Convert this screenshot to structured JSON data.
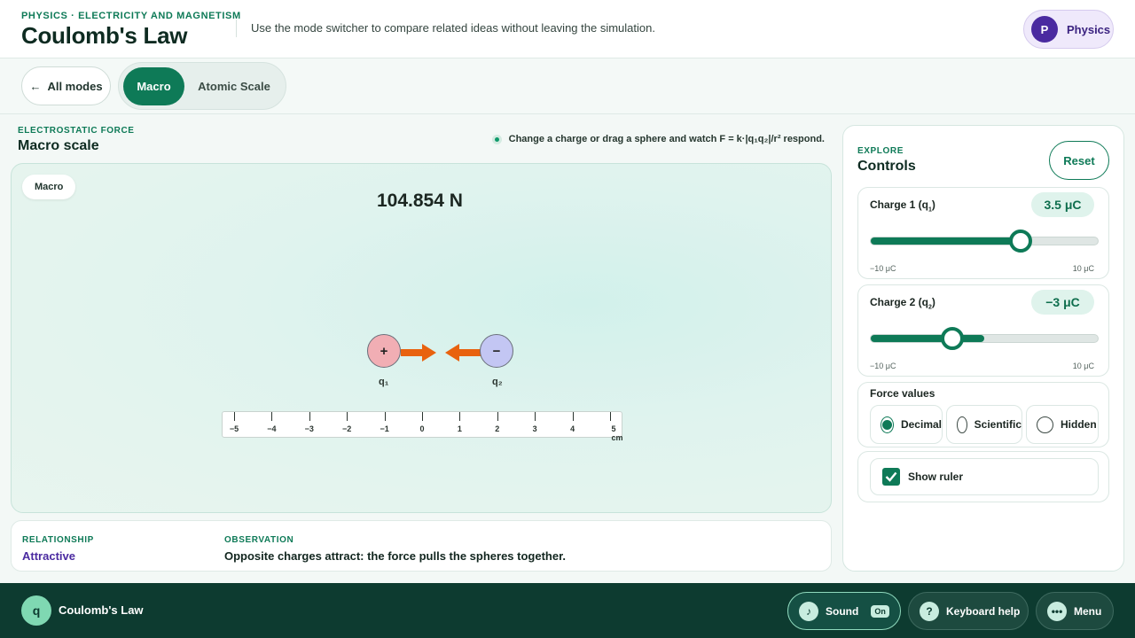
{
  "header": {
    "eyebrow": "PHYSICS · ELECTRICITY AND MAGNETISM",
    "title": "Coulomb's Law",
    "description": "Use the mode switcher to compare related ideas without leaving the simulation.",
    "profile": {
      "initial": "P",
      "label": "Physics"
    }
  },
  "modebar": {
    "back_label": "All modes",
    "modes": [
      {
        "label": "Macro",
        "active": true
      },
      {
        "label": "Atomic Scale",
        "active": false
      }
    ]
  },
  "section": {
    "eyebrow": "ELECTROSTATIC FORCE",
    "title": "Macro scale",
    "hint": "Change a charge or drag a sphere and watch F = k·|q₁q₂|/r² respond."
  },
  "stage": {
    "chip": "Macro",
    "force_readout": "104.854 N",
    "sphere1": {
      "symbol": "+",
      "label": "q₁"
    },
    "sphere2": {
      "symbol": "−",
      "label": "q₂"
    },
    "ruler": {
      "ticks": [
        "−5",
        "−4",
        "−3",
        "−2",
        "−1",
        "0",
        "1",
        "2",
        "3",
        "4",
        "5 cm"
      ]
    }
  },
  "info": {
    "relationship_label": "RELATIONSHIP",
    "relationship_value": "Attractive",
    "observation_label": "OBSERVATION",
    "observation_value": "Opposite charges attract: the force pulls the spheres together."
  },
  "controls": {
    "eyebrow": "EXPLORE",
    "title": "Controls",
    "reset_label": "Reset",
    "charge1": {
      "label": "Charge 1 (q",
      "sub": "1",
      "value": "3.5 μC",
      "min": "−10 μC",
      "max": "10 μC",
      "fraction": 0.66
    },
    "charge2": {
      "label": "Charge 2 (q",
      "sub": "2",
      "value": "−3 μC",
      "min": "−10 μC",
      "max": "10 μC",
      "fraction": 0.36
    },
    "force_values": {
      "label": "Force values",
      "options": [
        "Decimal",
        "Scientific",
        "Hidden"
      ],
      "selected": "Decimal"
    },
    "show_ruler": {
      "label": "Show ruler",
      "checked": true
    }
  },
  "footer": {
    "logo": "q",
    "title": "Coulomb's Law",
    "sound_label": "Sound",
    "sound_state": "On",
    "keyboard_label": "Keyboard help",
    "menu_label": "Menu"
  },
  "colors": {
    "accent": "#0e7a57",
    "footer_bg": "#0d3b30",
    "positive_charge": "#f1aeb4",
    "negative_charge": "#c3c6f3",
    "force_arrow": "#e8620f",
    "relationship": "#4a2aa0"
  }
}
